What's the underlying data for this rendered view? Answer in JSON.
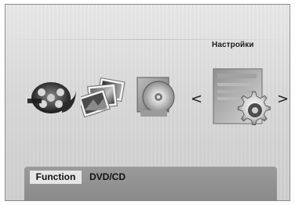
{
  "menu": {
    "selected_label": "Настройки",
    "items": [
      {
        "name": "Videos",
        "icon": "film-reel-icon"
      },
      {
        "name": "Photos",
        "icon": "photos-icon"
      },
      {
        "name": "Music",
        "icon": "music-cd-icon"
      },
      {
        "name": "Settings",
        "icon": "settings-gear-icon"
      }
    ],
    "left_arrow": "<",
    "right_arrow": ">"
  },
  "bottom_bar": {
    "function_label": "Function",
    "source_label": "DVD/CD"
  },
  "colors": {
    "background": "#d9d9d9",
    "bar": "#8f8f8f",
    "tag": "#e6e6e6"
  }
}
